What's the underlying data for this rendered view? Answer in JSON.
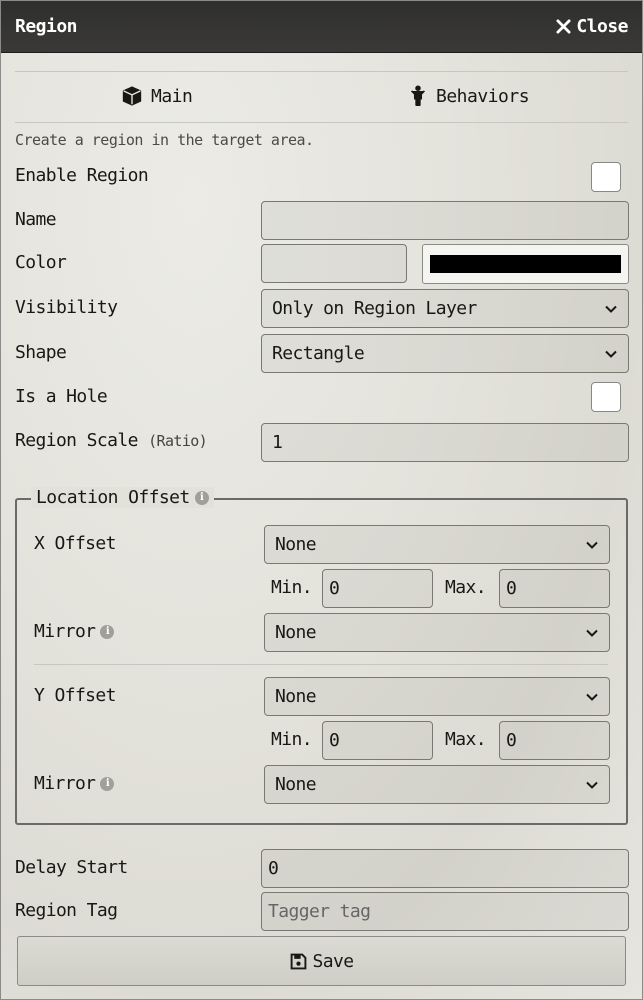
{
  "window": {
    "title": "Region",
    "close_label": "Close"
  },
  "tabs": [
    {
      "label": "Main",
      "icon": "cube-icon"
    },
    {
      "label": "Behaviors",
      "icon": "person-icon"
    }
  ],
  "hint": "Create a region in the target area.",
  "fields": {
    "enable_region": {
      "label": "Enable Region",
      "checked": false
    },
    "name": {
      "label": "Name",
      "value": ""
    },
    "color": {
      "label": "Color",
      "value": "",
      "swatch": "#000000"
    },
    "visibility": {
      "label": "Visibility",
      "value": "Only on Region Layer"
    },
    "shape": {
      "label": "Shape",
      "value": "Rectangle"
    },
    "is_hole": {
      "label": "Is a Hole",
      "checked": false
    },
    "region_scale": {
      "label": "Region Scale",
      "unit": "(Ratio)",
      "value": "1"
    }
  },
  "location_offset": {
    "legend": "Location Offset",
    "x": {
      "label": "X Offset",
      "value": "None",
      "min_label": "Min.",
      "min": "0",
      "max_label": "Max.",
      "max": "0",
      "mirror_label": "Mirror",
      "mirror": "None"
    },
    "y": {
      "label": "Y Offset",
      "value": "None",
      "min_label": "Min.",
      "min": "0",
      "max_label": "Max.",
      "max": "0",
      "mirror_label": "Mirror",
      "mirror": "None"
    }
  },
  "delay_start": {
    "label": "Delay Start",
    "value": "0"
  },
  "region_tag": {
    "label": "Region Tag",
    "placeholder": "Tagger tag"
  },
  "save_label": "Save"
}
